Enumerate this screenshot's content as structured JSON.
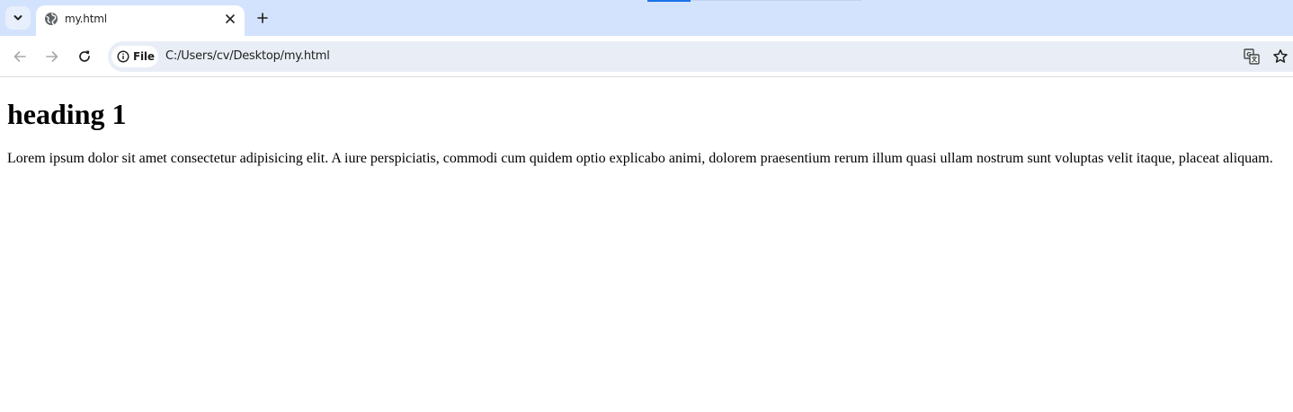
{
  "browser": {
    "tab": {
      "title": "my.html"
    },
    "toolbar": {
      "security_chip_label": "File",
      "url": "C:/Users/cv/Desktop/my.html"
    },
    "icons": {
      "tab_search": "chevron-down-icon",
      "favicon": "globe-icon",
      "tab_close": "close-icon",
      "new_tab": "plus-icon",
      "back": "arrow-left-icon",
      "forward": "arrow-right-icon",
      "reload": "reload-icon",
      "site_info": "info-icon",
      "translate": "translate-icon",
      "bookmark": "star-icon"
    },
    "colors": {
      "tabstrip_bg": "#d3e3fd",
      "omnibox_bg": "#e9eef6",
      "accent": "#1a73e8"
    }
  },
  "page": {
    "heading": "heading 1",
    "paragraph": "Lorem ipsum dolor sit amet consectetur adipisicing elit. A iure perspiciatis, commodi cum quidem optio explicabo animi, dolorem praesentium rerum illum quasi ullam nostrum sunt voluptas velit itaque, placeat aliquam."
  }
}
